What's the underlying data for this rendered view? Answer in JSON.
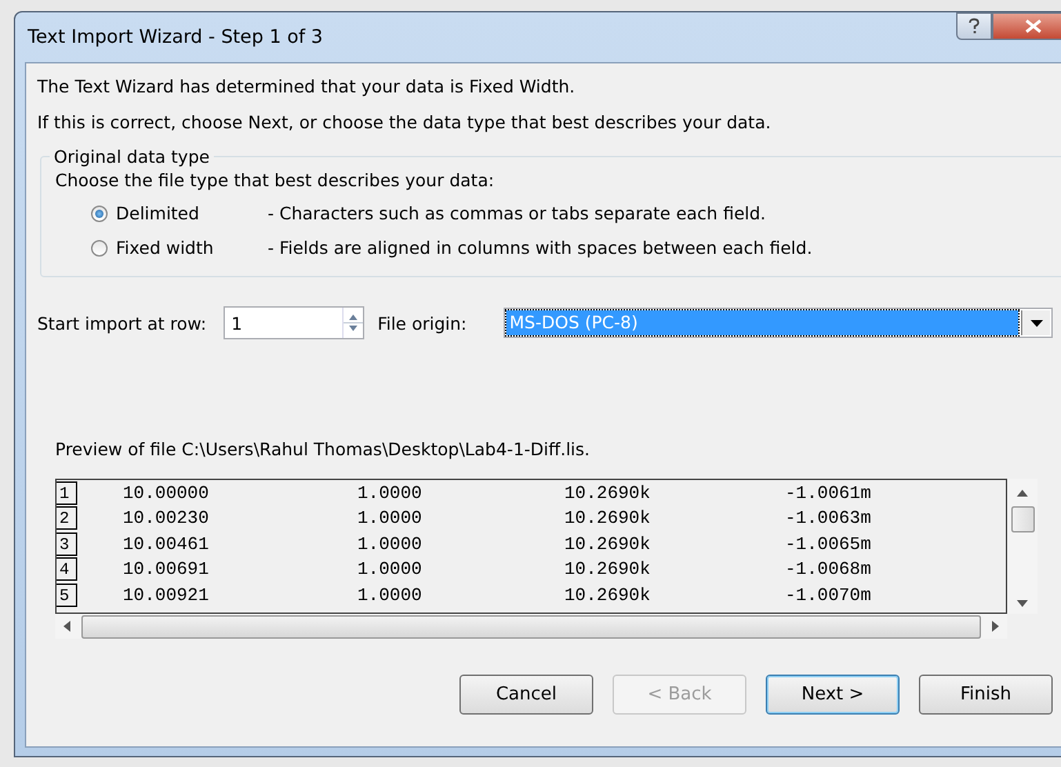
{
  "window": {
    "title": "Text Import Wizard - Step 1 of 3"
  },
  "intro": [
    "The Text Wizard has determined that your data is Fixed Width.",
    "If this is correct, choose Next, or choose the data type that best describes your data."
  ],
  "original_data_type": {
    "legend": "Original data type",
    "prompt": "Choose the file type that best describes your data:",
    "options": [
      {
        "label": "Delimited",
        "description": "- Characters such as commas or tabs separate each field.",
        "selected": true
      },
      {
        "label": "Fixed width",
        "description": "- Fields are aligned in columns with spaces between each field.",
        "selected": false
      }
    ]
  },
  "start_row": {
    "label": "Start import at row:",
    "value": "1"
  },
  "file_origin": {
    "label": "File origin:",
    "value": "MS-DOS (PC-8)"
  },
  "preview": {
    "label": "Preview of file C:\\Users\\Rahul Thomas\\Desktop\\Lab4-1-Diff.lis.",
    "rows": [
      {
        "number": "1",
        "cells": [
          "10.00000",
          "1.0000",
          "10.2690k",
          "-1.0061m"
        ]
      },
      {
        "number": "2",
        "cells": [
          "10.00230",
          "1.0000",
          "10.2690k",
          "-1.0063m"
        ]
      },
      {
        "number": "3",
        "cells": [
          "10.00461",
          "1.0000",
          "10.2690k",
          "-1.0065m"
        ]
      },
      {
        "number": "4",
        "cells": [
          "10.00691",
          "1.0000",
          "10.2690k",
          "-1.0068m"
        ]
      },
      {
        "number": "5",
        "cells": [
          "10.00921",
          "1.0000",
          "10.2690k",
          "-1.0070m"
        ]
      }
    ]
  },
  "buttons": [
    {
      "label": "Cancel",
      "disabled": false,
      "default": false
    },
    {
      "label": "< Back",
      "disabled": true,
      "default": false
    },
    {
      "label": "Next >",
      "disabled": false,
      "default": true
    },
    {
      "label": "Finish",
      "disabled": false,
      "default": false
    }
  ]
}
